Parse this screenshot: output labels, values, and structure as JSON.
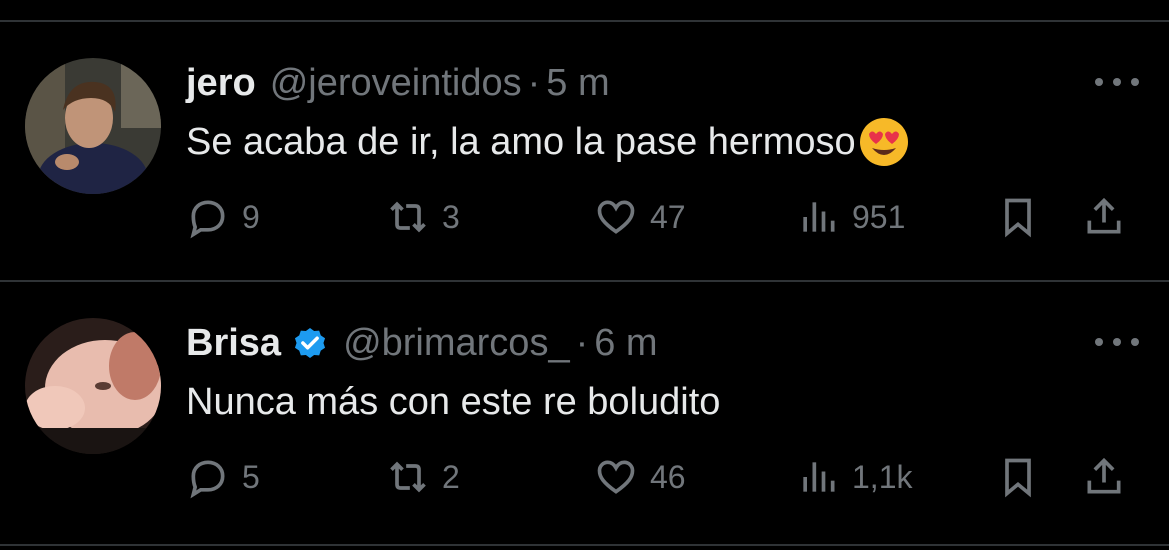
{
  "tweets": [
    {
      "name": "jero",
      "handle": "@jeroveintidos",
      "separator": "·",
      "time": "5 m",
      "text": "Se acaba de ir, la amo la pase hermoso",
      "emoji": "smiling-face-heart-eyes",
      "verified": false,
      "replies": "9",
      "retweets": "3",
      "likes": "47",
      "views": "951"
    },
    {
      "name": "Brisa",
      "handle": "@brimarcos_",
      "separator": "·",
      "time": "6 m",
      "text": "Nunca más con este re boludito",
      "verified": true,
      "replies": "5",
      "retweets": "2",
      "likes": "46",
      "views": "1,1k"
    }
  ],
  "colors": {
    "background": "#000000",
    "text": "#e7e9ea",
    "muted": "#71767b",
    "verified": "#1d9bf0",
    "divider": "#2f3336"
  }
}
